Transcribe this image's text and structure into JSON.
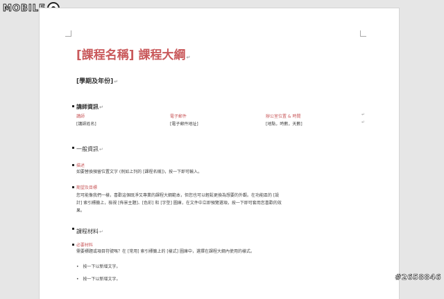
{
  "logo": {
    "text": "MOBILE",
    "suffix": "01"
  },
  "watermark": "#2658846",
  "document": {
    "title": "[課程名稱] 課程大綱",
    "subtitle": "[學期及年份]",
    "paragraph_mark": "↵",
    "instructor": {
      "heading": "講師資訊",
      "labels": [
        "講師",
        "電子郵件",
        "辦公室位置 & 時間"
      ],
      "values": [
        "[講師姓名]",
        "[電子郵件地址]",
        "[地點，時數，天數]"
      ]
    },
    "general": {
      "heading": "一般資訊",
      "description_label": "描述",
      "description_text": "如要替換預留位置文字 (例如上列的 [課程名稱])，按一下即可輸入。",
      "goals_label": "期望及目標",
      "goals_text": "您可能像我們一樣，喜歡這個既淨又專業的課程大綱範本，但您也可以輕鬆更換為想要的外觀。在功能區的 [設計] 索引標籤上，檢視 [佈景主題]、[色彩] 和 [字型] 圖庫，在文件中立即預覽選項，按一下即可套用您喜歡的效果。"
    },
    "materials": {
      "heading": "課程材料",
      "required_label": "必要材料",
      "required_text": "需要標題或項目符號嗎？在 [常用] 索引標籤上的 [樣式] 圖庫中，選擇在課程大綱內使用的樣式。",
      "list_items": [
        "按一下以新增文字。",
        "按一下以新增文字。"
      ]
    }
  }
}
